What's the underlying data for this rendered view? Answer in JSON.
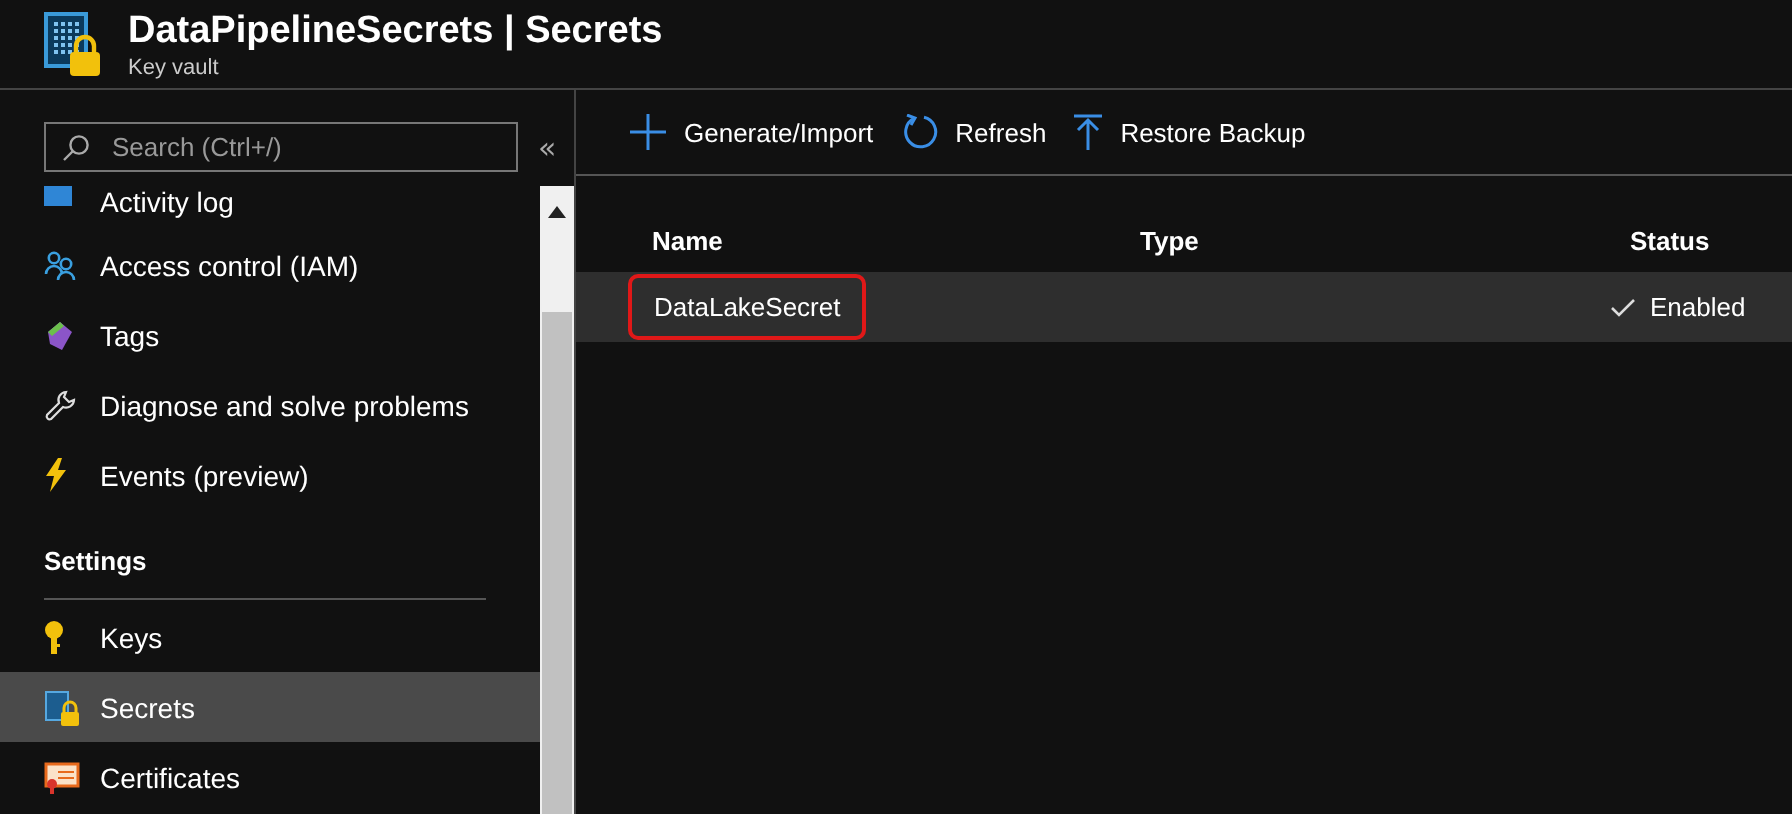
{
  "header": {
    "title": "DataPipelineSecrets | Secrets",
    "subtitle": "Key vault"
  },
  "sidebar": {
    "search": {
      "placeholder": "Search (Ctrl+/)"
    },
    "collapse": "«",
    "items": [
      {
        "kind": "link",
        "label": "Activity log",
        "selected": false
      },
      {
        "kind": "link",
        "label": "Access control (IAM)",
        "selected": false
      },
      {
        "kind": "link",
        "label": "Tags",
        "selected": false
      },
      {
        "kind": "link",
        "label": "Diagnose and solve problems",
        "selected": false
      },
      {
        "kind": "link",
        "label": "Events (preview)",
        "selected": false
      },
      {
        "kind": "section",
        "label": "Settings"
      },
      {
        "kind": "link",
        "label": "Keys",
        "selected": false
      },
      {
        "kind": "link",
        "label": "Secrets",
        "selected": true
      },
      {
        "kind": "link",
        "label": "Certificates",
        "selected": false
      }
    ]
  },
  "toolbar": [
    "Generate/Import",
    "Refresh",
    "Restore Backup"
  ],
  "table": {
    "columns": [
      "Name",
      "Type",
      "Status"
    ],
    "rows": [
      {
        "name": "DataLakeSecret",
        "status": "Enabled",
        "selected": true,
        "highlighted": true
      }
    ]
  }
}
